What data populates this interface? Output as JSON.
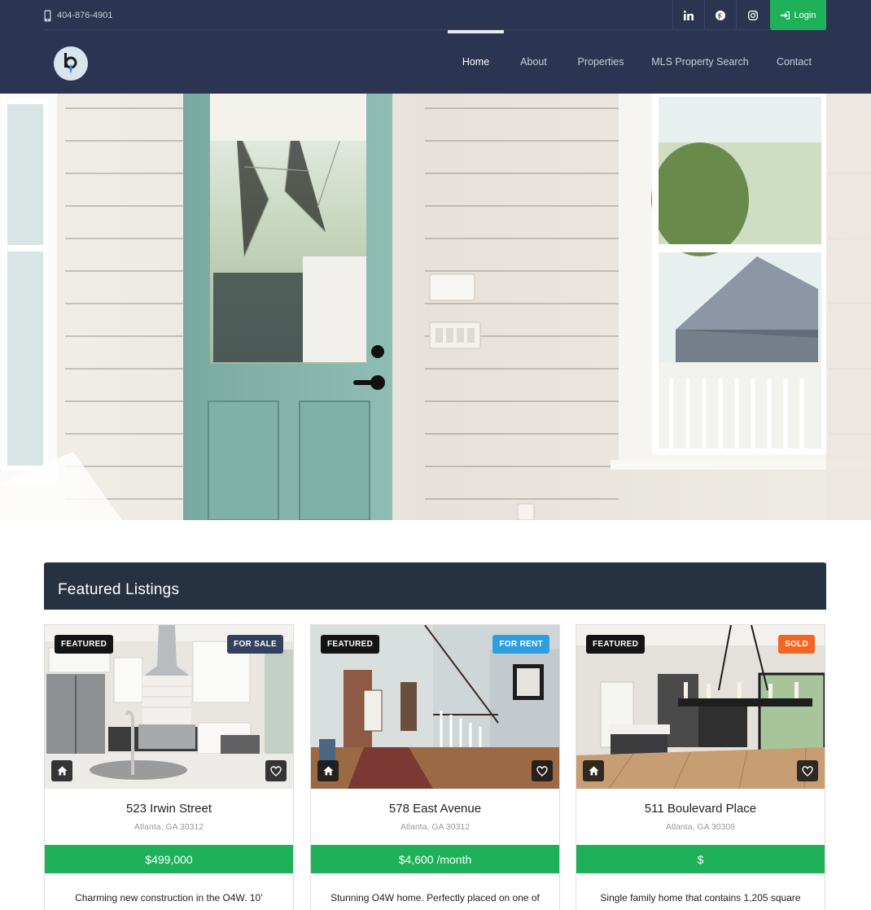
{
  "header": {
    "phone": "404-876-4901",
    "login_label": "Login",
    "social": [
      "linkedin-icon",
      "pinterest-icon",
      "instagram-icon"
    ],
    "logo_letter": "b",
    "nav": [
      {
        "label": "Home",
        "active": true
      },
      {
        "label": "About",
        "active": false
      },
      {
        "label": "Properties",
        "active": false
      },
      {
        "label": "MLS Property Search",
        "active": false
      },
      {
        "label": "Contact",
        "active": false
      }
    ]
  },
  "hero": {
    "description": "interior photo: teal entry door, white shiplap walls, windows"
  },
  "featured": {
    "title": "Featured Listings",
    "listings": [
      {
        "badge": "FEATURED",
        "status": "FOR SALE",
        "status_color": "#33415c",
        "title": "523 Irwin Street",
        "address": "Atlanta, GA 30312",
        "price": "$499,000",
        "description": "Charming new construction in the O4W. 10’"
      },
      {
        "badge": "FEATURED",
        "status": "FOR RENT",
        "status_color": "#2d9ee0",
        "title": "578 East Avenue",
        "address": "Atlanta, GA 30312",
        "price": "$4,600 /month",
        "description": "Stunning O4W home. Perfectly placed on one of"
      },
      {
        "badge": "FEATURED",
        "status": "SOLD",
        "status_color": "#f26522",
        "title": "511 Boulevard Place",
        "address": "Atlanta, GA 30308",
        "price": "$",
        "description": "Single family home that contains 1,205 square"
      }
    ]
  },
  "colors": {
    "header_bg": "#2b3450",
    "accent_green": "#1fb15a",
    "featured_bar": "#263142"
  }
}
